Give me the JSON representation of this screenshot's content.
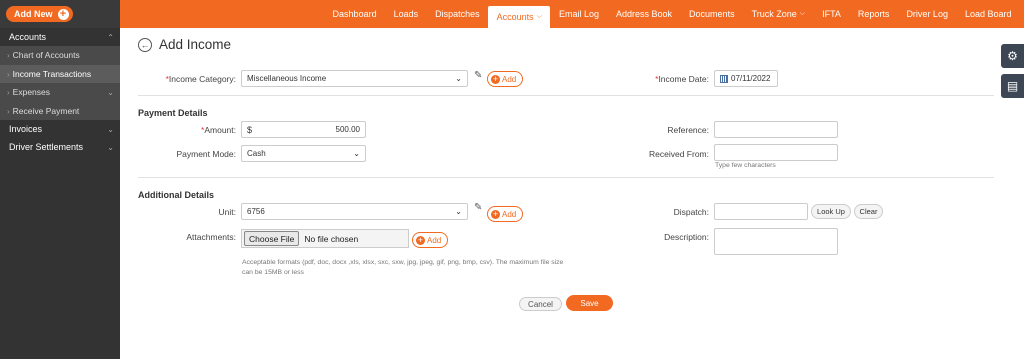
{
  "sidebar": {
    "add_new_label": "Add New",
    "sections": [
      {
        "label": "Accounts"
      },
      {
        "label": "Invoices"
      },
      {
        "label": "Driver Settlements"
      }
    ],
    "items": [
      {
        "label": "Chart of Accounts"
      },
      {
        "label": "Income Transactions"
      },
      {
        "label": "Expenses"
      },
      {
        "label": "Receive Payment"
      }
    ]
  },
  "nav": {
    "items": [
      {
        "label": "Dashboard"
      },
      {
        "label": "Loads"
      },
      {
        "label": "Dispatches"
      },
      {
        "label": "Accounts"
      },
      {
        "label": "Email Log"
      },
      {
        "label": "Address Book"
      },
      {
        "label": "Documents"
      },
      {
        "label": "Truck Zone"
      },
      {
        "label": "IFTA"
      },
      {
        "label": "Reports"
      },
      {
        "label": "Driver Log"
      },
      {
        "label": "Load Board"
      }
    ],
    "active": "Accounts"
  },
  "page": {
    "title": "Add Income"
  },
  "form": {
    "income_category_label": "Income Category:",
    "income_category_value": "Miscellaneous Income",
    "income_date_label": "Income Date:",
    "income_date_value": "07/11/2022",
    "add_label": "Add",
    "payment_details_heading": "Payment Details",
    "amount_label": "Amount:",
    "currency_symbol": "$",
    "amount_value": "500.00",
    "payment_mode_label": "Payment Mode:",
    "payment_mode_value": "Cash",
    "reference_label": "Reference:",
    "reference_value": "",
    "received_from_label": "Received From:",
    "received_from_value": "",
    "received_from_hint": "Type few characters",
    "additional_details_heading": "Additional Details",
    "unit_label": "Unit:",
    "unit_value": "6756",
    "dispatch_label": "Dispatch:",
    "dispatch_value": "",
    "look_up_label": "Look Up",
    "clear_label": "Clear",
    "attachments_label": "Attachments:",
    "choose_file_label": "Choose File",
    "no_file_label": "No file chosen",
    "attachments_hint": "Acceptable formats (pdf, doc, docx ,xls, xlsx, sxc, sxw, jpg, jpeg, gif, png, bmp, csv). The maximum file size can be 15MB or less",
    "description_label": "Description:",
    "description_value": "",
    "cancel_label": "Cancel",
    "save_label": "Save"
  },
  "colors": {
    "brand_orange": "#f26a21",
    "sidebar_dark": "#333333",
    "required_red": "#e53935"
  }
}
